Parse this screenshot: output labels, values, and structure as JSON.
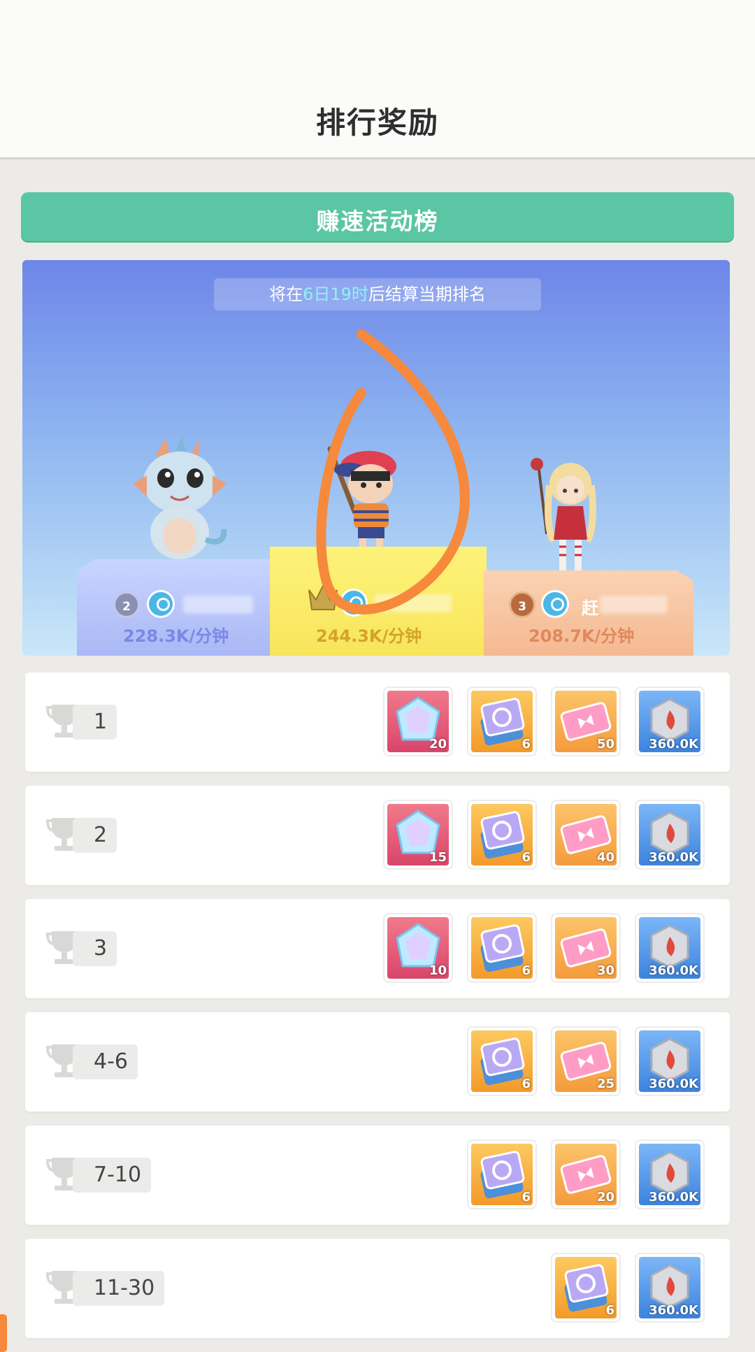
{
  "header": {
    "title": "排行奖励"
  },
  "tab": {
    "label": "赚速活动榜"
  },
  "countdown": {
    "prefix": "将在",
    "highlight": "6日19时",
    "suffix": "后结算当期排名"
  },
  "podium": [
    {
      "rank": "2",
      "speed": "228.3K/分钟",
      "color": "#7b88e6"
    },
    {
      "rank": "1",
      "speed": "244.3K/分钟",
      "color": "#d5a22c"
    },
    {
      "rank": "3",
      "speed": "208.7K/分钟",
      "color": "#e0885c",
      "name_partial": "赶"
    }
  ],
  "rewards": [
    {
      "rank": "1",
      "items": [
        {
          "type": "gem",
          "qty": "20"
        },
        {
          "type": "card",
          "qty": "6"
        },
        {
          "type": "ticket",
          "qty": "50"
        },
        {
          "type": "stone",
          "qty": "360.0K"
        }
      ]
    },
    {
      "rank": "2",
      "items": [
        {
          "type": "gem",
          "qty": "15"
        },
        {
          "type": "card",
          "qty": "6"
        },
        {
          "type": "ticket",
          "qty": "40"
        },
        {
          "type": "stone",
          "qty": "360.0K"
        }
      ]
    },
    {
      "rank": "3",
      "items": [
        {
          "type": "gem",
          "qty": "10"
        },
        {
          "type": "card",
          "qty": "6"
        },
        {
          "type": "ticket",
          "qty": "30"
        },
        {
          "type": "stone",
          "qty": "360.0K"
        }
      ]
    },
    {
      "rank": "4-6",
      "items": [
        {
          "type": "card",
          "qty": "6"
        },
        {
          "type": "ticket",
          "qty": "25"
        },
        {
          "type": "stone",
          "qty": "360.0K"
        }
      ]
    },
    {
      "rank": "7-10",
      "items": [
        {
          "type": "card",
          "qty": "6"
        },
        {
          "type": "ticket",
          "qty": "20"
        },
        {
          "type": "stone",
          "qty": "360.0K"
        }
      ]
    },
    {
      "rank": "11-30",
      "items": [
        {
          "type": "card",
          "qty": "6"
        },
        {
          "type": "stone",
          "qty": "360.0K"
        }
      ]
    }
  ],
  "colors": {
    "accent_green": "#5ac6a3",
    "annotation_orange": "#f6893b"
  }
}
